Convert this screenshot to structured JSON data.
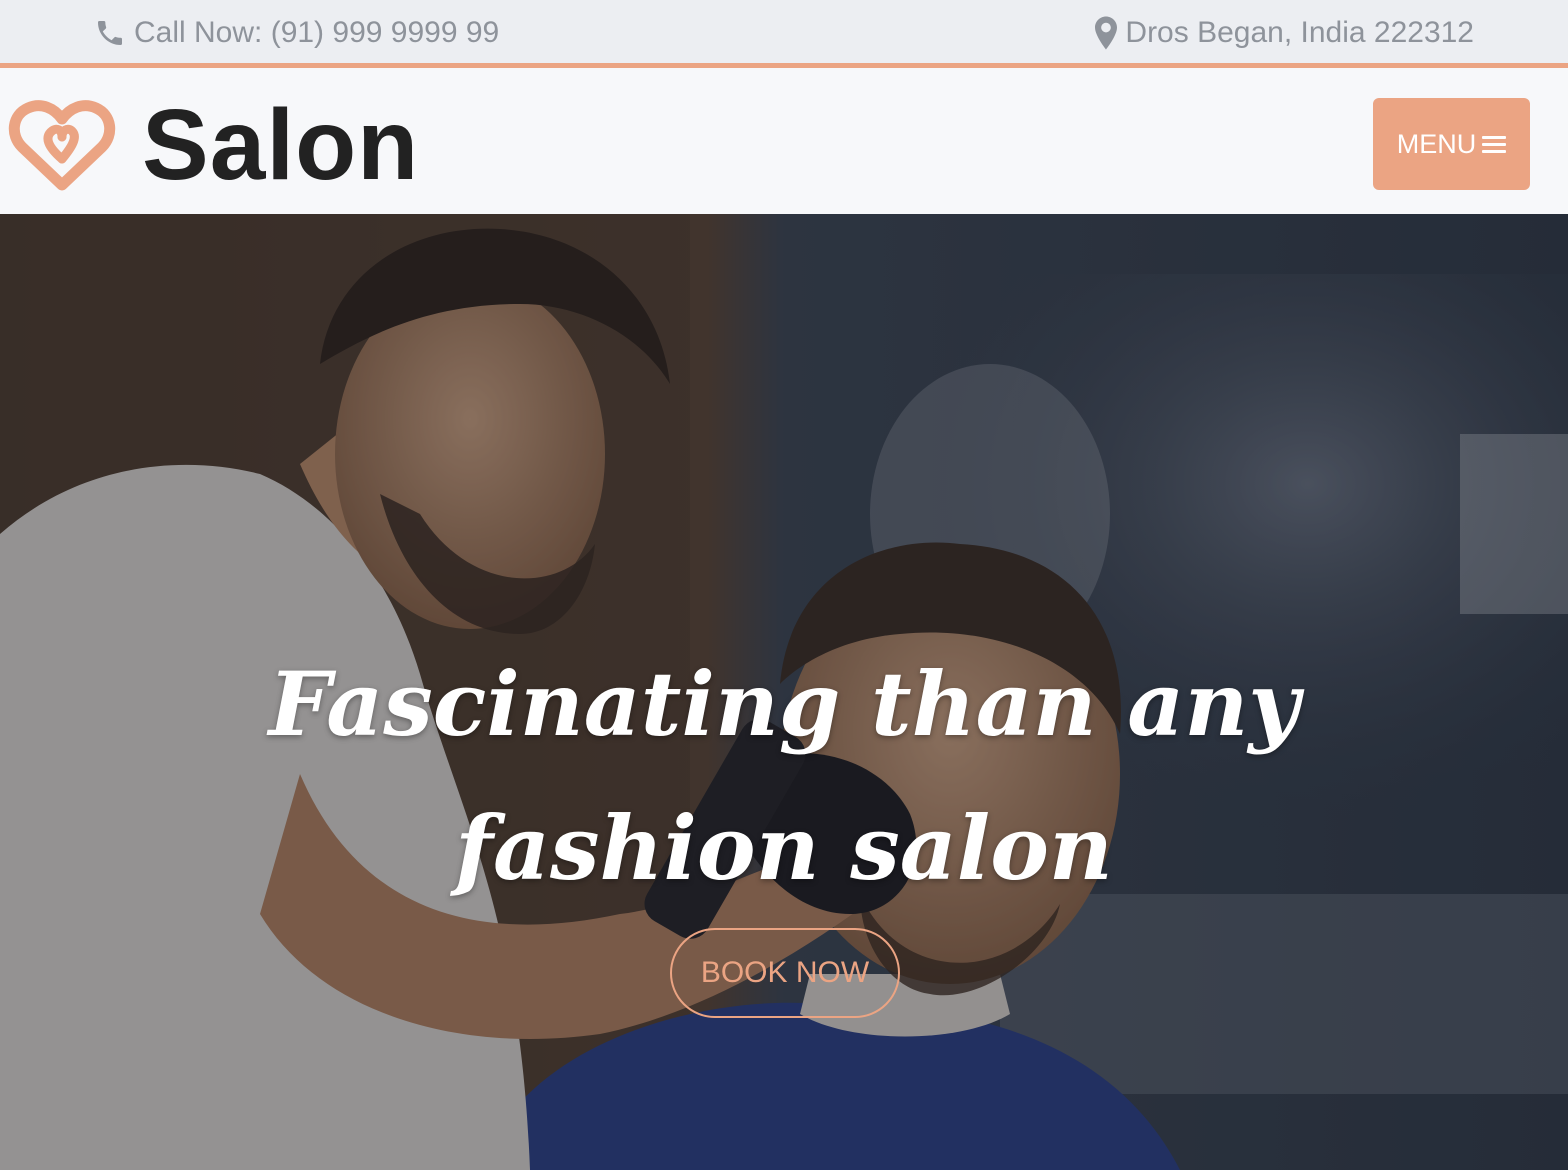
{
  "topbar": {
    "phone_text": "Call Now: (91) 999 9999 99",
    "address_text": "Dros Began, India 222312",
    "phone_icon": "phone-icon",
    "address_icon": "map-marker-icon"
  },
  "header": {
    "brand_name": "Salon",
    "logo_icon": "heart-logo-icon",
    "menu_label": "MENU",
    "menu_icon": "hamburger-icon"
  },
  "hero": {
    "title_line1": "Fascinating than any",
    "title_line2": "fashion salon",
    "cta_label": "BOOK NOW"
  },
  "colors": {
    "accent": "#eba483",
    "topbar_bg": "#eceef2",
    "header_bg": "#f7f8fa",
    "muted_text": "#8e939b",
    "brand_text": "#222222"
  }
}
